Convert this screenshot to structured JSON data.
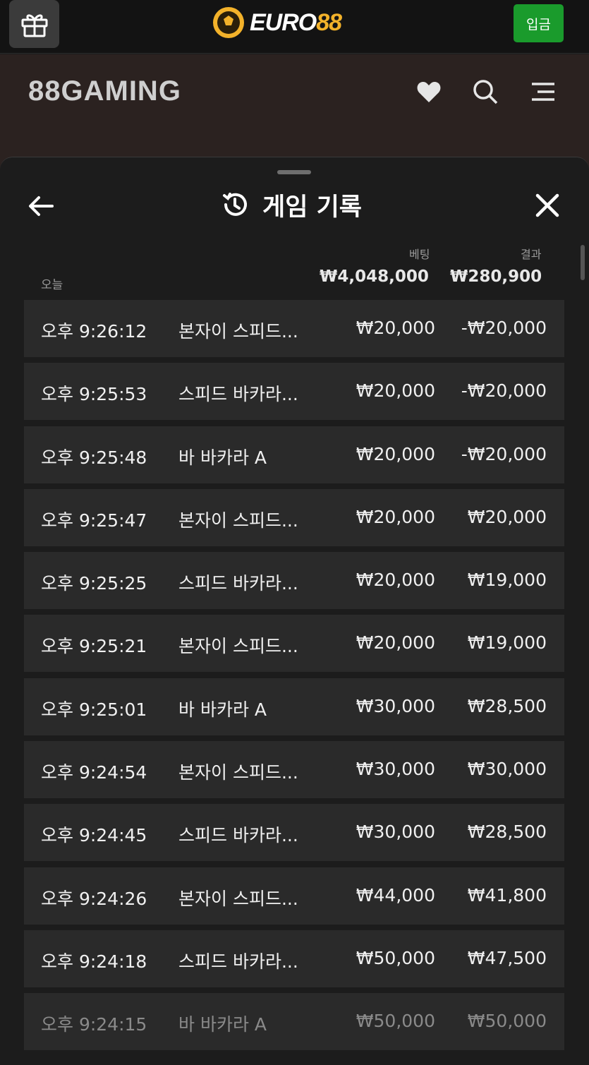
{
  "topbar": {
    "brand_name": "EURO",
    "brand_num": "88",
    "deposit_label": "입금"
  },
  "gamebar": {
    "logo": "88GAMING"
  },
  "sheet": {
    "title": "게임 기록",
    "bet_header": "베팅",
    "result_header": "결과",
    "day_label": "오늘",
    "bet_total": "₩4,048,000",
    "result_total": "₩280,900"
  },
  "rows": [
    {
      "time": "오후 9:26:12",
      "game": "본자이 스피드...",
      "bet": "₩20,000",
      "result": "-₩20,000"
    },
    {
      "time": "오후 9:25:53",
      "game": "스피드 바카라...",
      "bet": "₩20,000",
      "result": "-₩20,000"
    },
    {
      "time": "오후 9:25:48",
      "game": "바 바카라 A",
      "bet": "₩20,000",
      "result": "-₩20,000"
    },
    {
      "time": "오후 9:25:47",
      "game": "본자이 스피드...",
      "bet": "₩20,000",
      "result": "₩20,000"
    },
    {
      "time": "오후 9:25:25",
      "game": "스피드 바카라...",
      "bet": "₩20,000",
      "result": "₩19,000"
    },
    {
      "time": "오후 9:25:21",
      "game": "본자이 스피드...",
      "bet": "₩20,000",
      "result": "₩19,000"
    },
    {
      "time": "오후 9:25:01",
      "game": "바 바카라 A",
      "bet": "₩30,000",
      "result": "₩28,500"
    },
    {
      "time": "오후 9:24:54",
      "game": "본자이 스피드...",
      "bet": "₩30,000",
      "result": "₩30,000"
    },
    {
      "time": "오후 9:24:45",
      "game": "스피드 바카라...",
      "bet": "₩30,000",
      "result": "₩28,500"
    },
    {
      "time": "오후 9:24:26",
      "game": "본자이 스피드...",
      "bet": "₩44,000",
      "result": "₩41,800"
    },
    {
      "time": "오후 9:24:18",
      "game": "스피드 바카라...",
      "bet": "₩50,000",
      "result": "₩47,500"
    },
    {
      "time": "오후 9:24:15",
      "game": "바 바카라 A",
      "bet": "₩50,000",
      "result": "₩50,000"
    }
  ],
  "icons": {
    "gift": "gift-icon",
    "ball": "soccer-ball-icon",
    "heart": "heart-icon",
    "search": "search-icon",
    "menu": "menu-icon",
    "history": "history-icon",
    "back": "arrow-left-icon",
    "close": "close-icon"
  },
  "colors": {
    "deposit": "#1a9b2c",
    "brand_accent": "#f3b22a",
    "row_bg": "#2a2a2a",
    "sheet_bg": "#1c1c1c"
  }
}
